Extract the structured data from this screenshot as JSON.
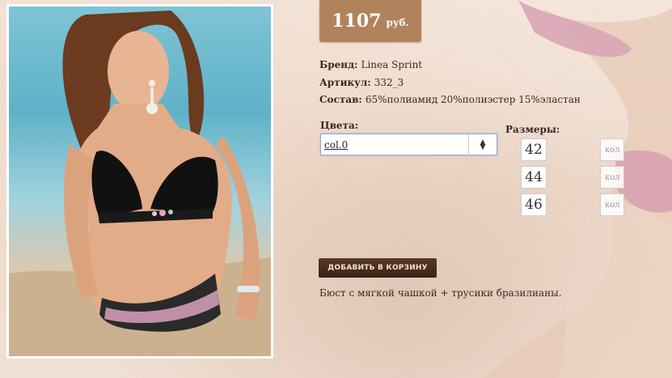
{
  "product": {
    "price": "1107",
    "currency": "руб.",
    "brand_label": "Бренд:",
    "brand_value": "Linea Sprint",
    "sku_label": "Артикул:",
    "sku_value": "332_3",
    "composition_label": "Состав:",
    "composition_value": "65%полиамид 20%полиэстер 15%эластан",
    "colors_label": "Цвета:",
    "color_selected": "col.0",
    "sizes_label": "Размеры:",
    "sizes": [
      "42",
      "44",
      "46"
    ],
    "qty_placeholder": "кол",
    "add_to_cart": "ДОБАВИТЬ В КОРЗИНУ",
    "description": "Бюст с мягкой чашкой + трусики бразилианы."
  },
  "colors": {
    "price_bg": "#b0835d",
    "button_bg": "#3a2219"
  }
}
